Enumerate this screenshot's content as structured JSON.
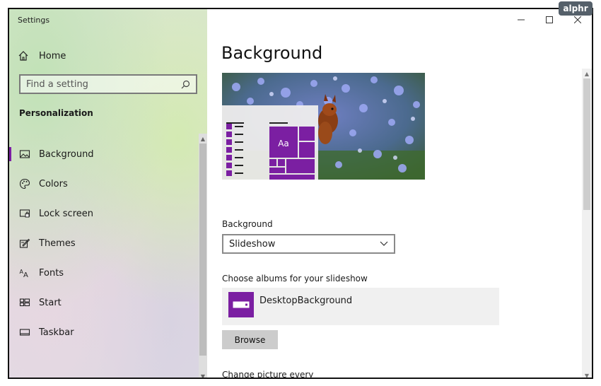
{
  "window": {
    "title": "Settings"
  },
  "brand": {
    "text": "alphr"
  },
  "sidebar": {
    "home_label": "Home",
    "search": {
      "placeholder": "Find a setting"
    },
    "section_title": "Personalization",
    "items": [
      {
        "label": "Background",
        "icon": "picture-icon",
        "active": true
      },
      {
        "label": "Colors",
        "icon": "palette-icon",
        "active": false
      },
      {
        "label": "Lock screen",
        "icon": "lock-screen-icon",
        "active": false
      },
      {
        "label": "Themes",
        "icon": "themes-icon",
        "active": false
      },
      {
        "label": "Fonts",
        "icon": "fonts-icon",
        "active": false
      },
      {
        "label": "Start",
        "icon": "start-icon",
        "active": false
      },
      {
        "label": "Taskbar",
        "icon": "taskbar-icon",
        "active": false
      }
    ]
  },
  "main": {
    "title": "Background",
    "preview": {
      "sample_text": "Aa",
      "accent": "#7b1fa2"
    },
    "background_label": "Background",
    "background_value": "Slideshow",
    "albums_label": "Choose albums for your slideshow",
    "album_name": "DesktopBackground",
    "browse_label": "Browse",
    "change_label": "Change picture every"
  },
  "colors": {
    "accent": "#7b1fa2",
    "button": "#cccccc"
  }
}
